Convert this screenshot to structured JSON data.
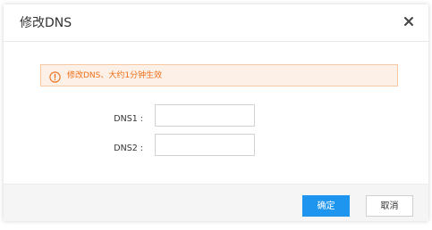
{
  "dialog": {
    "title": "修改DNS",
    "close_icon": "close-icon"
  },
  "alert": {
    "icon": "exclamation-circle-icon",
    "text": "修改DNS、大约1分钟生效",
    "color": "#ee6f1a",
    "background": "#fdf0e6"
  },
  "form": {
    "dns1": {
      "label": "DNS1 :",
      "value": "",
      "placeholder": ""
    },
    "dns2": {
      "label": "DNS2 :",
      "value": "",
      "placeholder": ""
    }
  },
  "footer": {
    "ok_label": "确定",
    "cancel_label": "取消",
    "ok_color": "#1e96f0"
  }
}
